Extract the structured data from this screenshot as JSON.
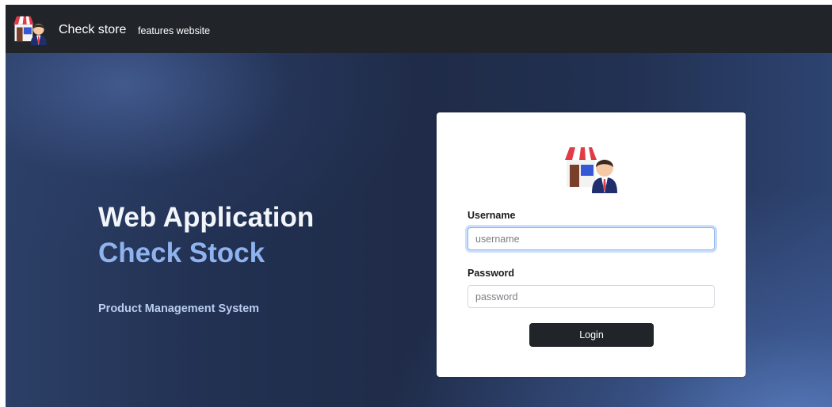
{
  "navbar": {
    "logo_icon": "store-clerk-icon",
    "brand": "Check store",
    "link": "features website",
    "background": "#212529"
  },
  "hero": {
    "title_line1": "Web Application",
    "title_line2": "Check Stock",
    "subtitle": "Product Management System",
    "accent_color": "#8fb3ef"
  },
  "login": {
    "logo_icon": "store-clerk-icon",
    "username_label": "Username",
    "username_placeholder": "username",
    "username_value": "",
    "password_label": "Password",
    "password_placeholder": "password",
    "password_value": "",
    "button_label": "Login",
    "focused_field": "username"
  }
}
